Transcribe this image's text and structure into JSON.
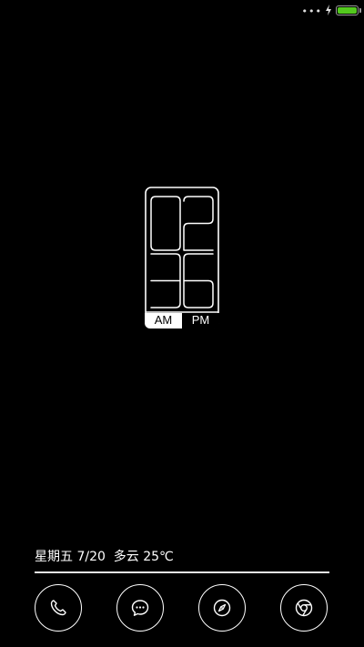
{
  "status_bar": {
    "signal_dots": "•••",
    "battery_level": 1.0,
    "battery_color": "#53c91e",
    "charging_icon": "bolt-icon"
  },
  "clock": {
    "hours": "02",
    "minutes": "36",
    "am_label": "AM",
    "pm_label": "PM",
    "active_period": "AM"
  },
  "weather": {
    "text": "星期五 7/20  多云 25℃"
  },
  "dock": {
    "items": [
      {
        "icon": "phone-icon"
      },
      {
        "icon": "message-icon"
      },
      {
        "icon": "compass-icon"
      },
      {
        "icon": "browser-icon"
      }
    ]
  }
}
